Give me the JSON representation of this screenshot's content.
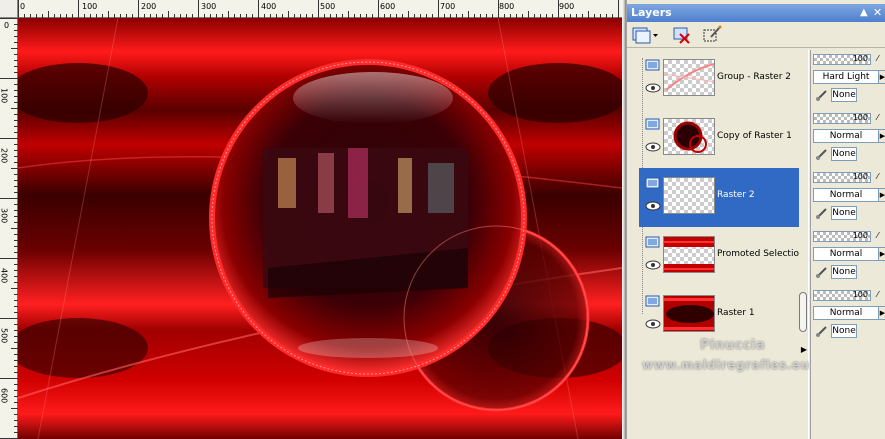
{
  "canvas": {
    "ruler_h_labels": [
      "0",
      "100",
      "200",
      "300",
      "400",
      "500",
      "600",
      "700",
      "800",
      "900"
    ],
    "ruler_v_labels": [
      "0",
      "100",
      "200",
      "300",
      "400",
      "500",
      "600"
    ]
  },
  "layers_panel": {
    "title": "Layers",
    "icons": {
      "pin": "pin-icon",
      "close": "close-icon",
      "new_layer": "new-raster-layer-icon",
      "delete_layer": "delete-layer-icon",
      "edit_selection": "edit-selection-icon"
    },
    "layers": [
      {
        "name": "Group - Raster 2",
        "opacity": "100",
        "blend": "Hard Light",
        "mask": "None",
        "selected": false
      },
      {
        "name": "Copy of Raster 1",
        "opacity": "100",
        "blend": "Normal",
        "mask": "None",
        "selected": false
      },
      {
        "name": "Raster 2",
        "opacity": "100",
        "blend": "Normal",
        "mask": "None",
        "selected": true
      },
      {
        "name": "Promoted Selection",
        "opacity": "100",
        "blend": "Normal",
        "mask": "None",
        "selected": false
      },
      {
        "name": "Raster 1",
        "opacity": "100",
        "blend": "Normal",
        "mask": "None",
        "selected": false
      }
    ],
    "selection_color": "#316ac5"
  },
  "watermark": {
    "line1": "Pinuccia",
    "line2": "www.maldiregrafies.eu"
  }
}
